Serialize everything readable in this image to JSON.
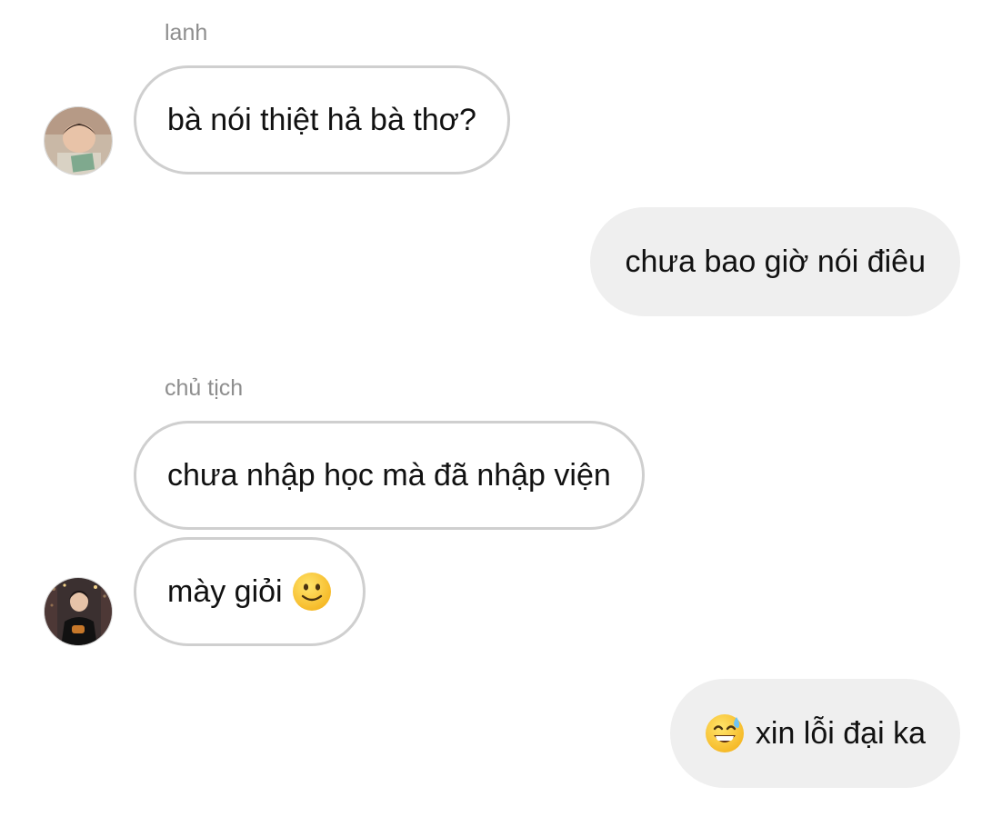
{
  "messages": [
    {
      "direction": "incoming",
      "sender": "lanh",
      "text": "bà nói thiệt hả bà thơ?",
      "avatar_icon": "avatar-lanh"
    },
    {
      "direction": "outgoing",
      "text": "chưa bao giờ nói điêu"
    },
    {
      "direction": "incoming",
      "sender": "chủ tịch",
      "text": "chưa nhập học mà đã nhập viện"
    },
    {
      "direction": "incoming",
      "text": "mày giỏi",
      "trailing_emoji": "slightly-smiling-face-icon",
      "avatar_icon": "avatar-chu-tich"
    },
    {
      "direction": "outgoing",
      "leading_emoji": "grinning-face-with-sweat-icon",
      "text": "xin lỗi đại ka"
    }
  ],
  "colors": {
    "incoming_bubble_border": "#cfcfcf",
    "outgoing_bubble_bg": "#efefef",
    "sender_name_text": "#8e8e8e",
    "message_text": "#111111"
  }
}
